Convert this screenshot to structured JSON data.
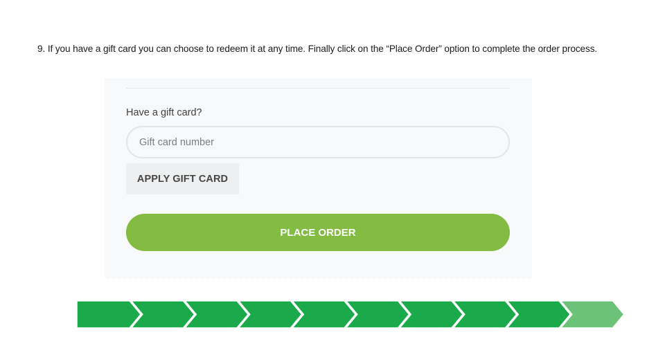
{
  "instruction": {
    "text": "9. If you have a gift card you can choose to redeem it at any time. Finally click on the “Place Order” option to complete the order process."
  },
  "gift_card": {
    "label": "Have a gift card?",
    "input_value": "",
    "input_placeholder": "Gift card number",
    "apply_label": "APPLY GIFT CARD"
  },
  "order": {
    "place_order_label": "PLACE ORDER"
  },
  "progress": {
    "total_steps": 10,
    "completed_steps": 9,
    "completed_color": "#1aaa4c",
    "current_color": "#6dc27a"
  },
  "colors": {
    "place_order_bg": "#84bb42",
    "panel_bg": "#f8f9fa"
  }
}
